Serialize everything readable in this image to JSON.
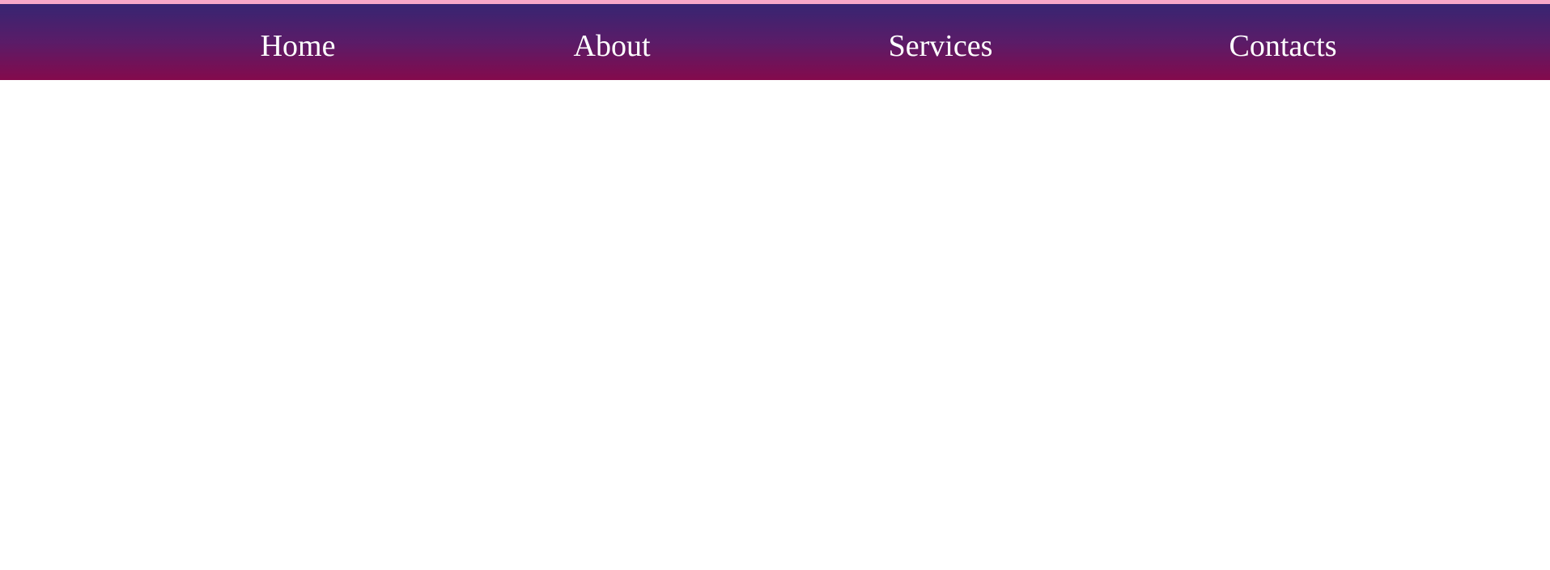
{
  "colors": {
    "top_strip": "#f7a8c8",
    "nav_gradient_top": "#372572",
    "nav_gradient_bottom": "#840a4c",
    "nav_text": "#ffffff",
    "page_background": "#ffffff"
  },
  "nav": {
    "items": [
      {
        "label": "Home"
      },
      {
        "label": "About"
      },
      {
        "label": "Services"
      },
      {
        "label": "Contacts"
      }
    ]
  }
}
